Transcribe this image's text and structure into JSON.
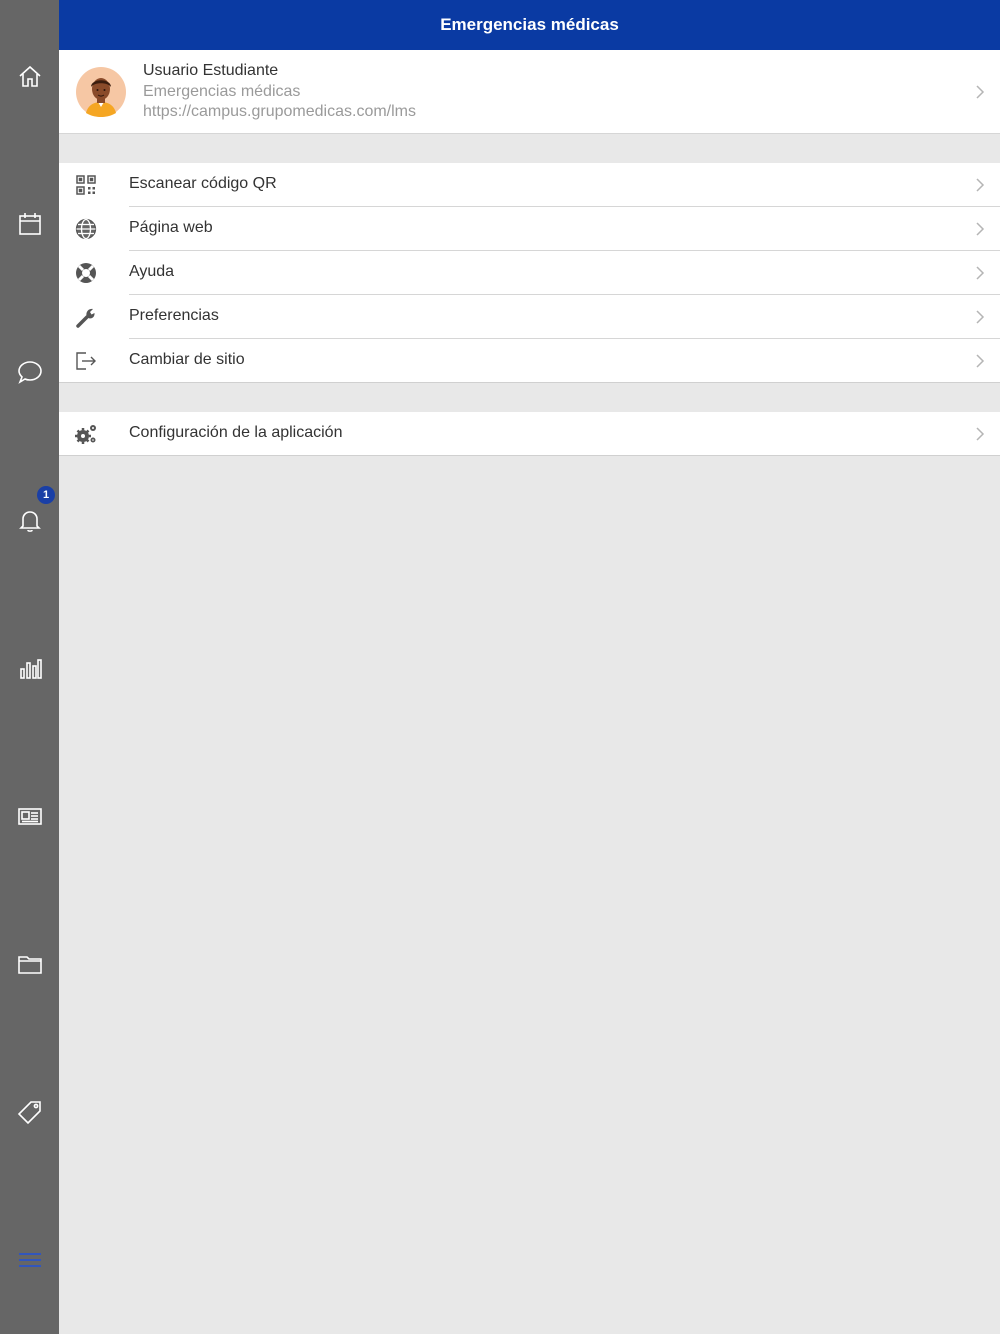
{
  "header": {
    "title": "Emergencias médicas"
  },
  "user": {
    "name": "Usuario Estudiante",
    "site": "Emergencias médicas",
    "url": "https://campus.grupomedicas.com/lms"
  },
  "menu": [
    {
      "label": "Escanear código QR",
      "icon": "qr-code-icon"
    },
    {
      "label": "Página web",
      "icon": "globe-icon"
    },
    {
      "label": "Ayuda",
      "icon": "lifebuoy-icon"
    },
    {
      "label": "Preferencias",
      "icon": "wrench-icon"
    },
    {
      "label": "Cambiar de sitio",
      "icon": "sign-out-icon"
    }
  ],
  "settings": [
    {
      "label": "Configuración de la aplicación",
      "icon": "gears-icon"
    }
  ],
  "sidebar": {
    "items": [
      {
        "name": "home",
        "icon": "home-icon"
      },
      {
        "name": "calendar",
        "icon": "calendar-icon"
      },
      {
        "name": "messages",
        "icon": "chat-bubble-icon"
      },
      {
        "name": "notifications",
        "icon": "bell-icon",
        "badge": "1"
      },
      {
        "name": "grades",
        "icon": "bar-chart-icon"
      },
      {
        "name": "news",
        "icon": "newspaper-icon"
      },
      {
        "name": "files",
        "icon": "folder-icon"
      },
      {
        "name": "tags",
        "icon": "tag-icon"
      },
      {
        "name": "more",
        "icon": "hamburger-menu-icon"
      }
    ]
  },
  "colors": {
    "header": "#0a3aa3",
    "sidebar": "#666666",
    "background": "#e8e8e8",
    "badge": "#1a3fa6",
    "active_icon": "#2b55c8"
  }
}
